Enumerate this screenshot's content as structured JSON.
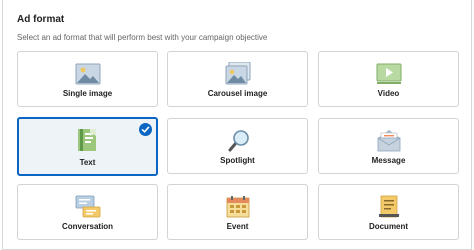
{
  "header": {
    "title": "Ad format",
    "subtitle": "Select an ad format that will perform best with your campaign objective"
  },
  "formats": [
    {
      "label": "Single image",
      "icon": "image-icon",
      "selected": false
    },
    {
      "label": "Carousel image",
      "icon": "carousel-image-icon",
      "selected": false
    },
    {
      "label": "Video",
      "icon": "video-icon",
      "selected": false
    },
    {
      "label": "Text",
      "icon": "text-ad-icon",
      "selected": true
    },
    {
      "label": "Spotlight",
      "icon": "magnifier-icon",
      "selected": false
    },
    {
      "label": "Message",
      "icon": "envelope-icon",
      "selected": false
    },
    {
      "label": "Conversation",
      "icon": "chat-bubbles-icon",
      "selected": false
    },
    {
      "label": "Event",
      "icon": "calendar-icon",
      "selected": false
    },
    {
      "label": "Document",
      "icon": "document-icon",
      "selected": false
    }
  ],
  "colors": {
    "accent": "#0a66c2",
    "selected_bg": "#eef3f8",
    "border": "#d3d3d3"
  }
}
